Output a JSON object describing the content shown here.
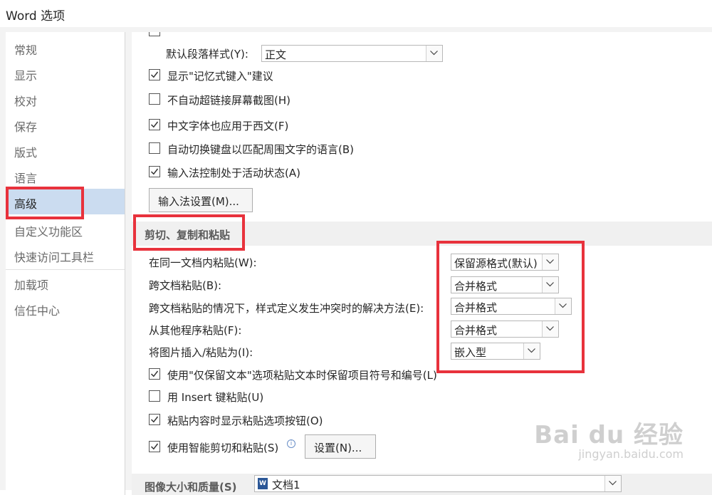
{
  "window": {
    "title": "Word 选项"
  },
  "sidebar": {
    "items": [
      {
        "label": "常规"
      },
      {
        "label": "显示"
      },
      {
        "label": "校对"
      },
      {
        "label": "保存"
      },
      {
        "label": "版式"
      },
      {
        "label": "语言"
      },
      {
        "label": "高级"
      },
      {
        "label": "自定义功能区"
      },
      {
        "label": "快速访问工具栏"
      },
      {
        "label": "加载项"
      },
      {
        "label": "信任中心"
      }
    ],
    "active": "高级"
  },
  "editing": {
    "default_paragraph_label": "默认段落样式(Y):",
    "default_paragraph_value": "正文",
    "options": [
      {
        "label": "显示\"记忆式键入\"建议",
        "checked": true
      },
      {
        "label": "不自动超链接屏幕截图(H)",
        "checked": false
      },
      {
        "label": "中文字体也应用于西文(F)",
        "checked": true
      },
      {
        "label": "自动切换键盘以匹配周围文字的语言(B)",
        "checked": false
      },
      {
        "label": "输入法控制处于活动状态(A)",
        "checked": true
      }
    ],
    "ime_button": "输入法设置(M)..."
  },
  "cut_copy_paste": {
    "header": "剪切、复制和粘贴",
    "rows": [
      {
        "label": "在同一文档内粘贴(W):",
        "value": "保留源格式(默认)"
      },
      {
        "label": "跨文档粘贴(B):",
        "value": "合并格式"
      },
      {
        "label": "跨文档粘贴的情况下，样式定义发生冲突时的解决方法(E):",
        "value": "合并格式"
      },
      {
        "label": "从其他程序粘贴(F):",
        "value": "合并格式"
      },
      {
        "label": "将图片插入/粘贴为(I):",
        "value": "嵌入型"
      }
    ],
    "options": [
      {
        "label": "使用\"仅保留文本\"选项粘贴文本时保留项目符号和编号(L)",
        "checked": true
      },
      {
        "label": "用 Insert 键粘贴(U)",
        "checked": false
      },
      {
        "label": "粘贴内容时显示粘贴选项按钮(O)",
        "checked": true
      },
      {
        "label": "使用智能剪切和粘贴(S)",
        "checked": true
      }
    ],
    "settings_button": "设置(N)..."
  },
  "image_section": {
    "header": "图像大小和质量(S)",
    "doc_value": "文档1"
  },
  "watermark": {
    "brand": "Bai du 经验",
    "sub": "jingyan.baidu.com"
  },
  "colors": {
    "highlight": "#e8323c",
    "active_nav": "#cbdcf0"
  }
}
